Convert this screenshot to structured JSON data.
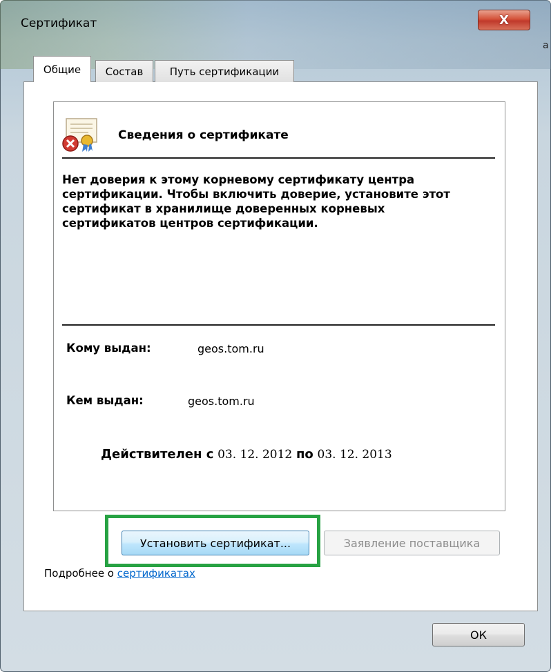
{
  "window": {
    "title": "Сертификат",
    "close_label": "X",
    "edge_letter": "a"
  },
  "tabs": [
    {
      "label": "Общие",
      "active": true
    },
    {
      "label": "Состав",
      "active": false
    },
    {
      "label": "Путь сертификации",
      "active": false
    }
  ],
  "info": {
    "heading": "Сведения о сертификате",
    "warning": "Нет доверия к этому корневому сертификату центра сертификации. Чтобы включить доверие, установите этот сертификат в хранилище доверенных корневых сертификатов центров сертификации.",
    "issued_to_label": "Кому выдан:",
    "issued_to_value": "geos.tom.ru",
    "issued_by_label": "Кем выдан:",
    "issued_by_value": "geos.tom.ru",
    "valid_from_label": "Действителен с",
    "valid_from": "03. 12. 2012",
    "valid_to_label": "по",
    "valid_to": "03. 12. 2013"
  },
  "buttons": {
    "install": "Установить сертификат...",
    "issuer_statement": "Заявление поставщика",
    "ok": "ОК"
  },
  "footer": {
    "more_prefix": "Подробнее о ",
    "more_link": "сертификатах"
  },
  "colors": {
    "highlight": "#27a243",
    "link": "#0066cc"
  }
}
